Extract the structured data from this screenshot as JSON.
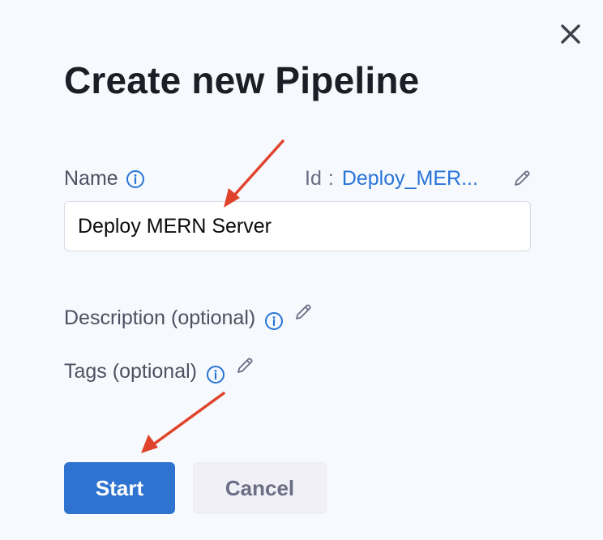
{
  "dialog": {
    "title": "Create new Pipeline",
    "close_icon": "close-icon"
  },
  "name_field": {
    "label": "Name",
    "value": "Deploy MERN Server",
    "info_icon": "info-icon"
  },
  "identifier": {
    "label": "Id",
    "separator": ":",
    "value": "Deploy_MER...",
    "edit_icon": "pencil-icon"
  },
  "description": {
    "label": "Description (optional)",
    "info_icon": "info-icon",
    "edit_icon": "pencil-icon"
  },
  "tags": {
    "label": "Tags (optional)",
    "info_icon": "info-icon",
    "edit_icon": "pencil-icon"
  },
  "actions": {
    "start_label": "Start",
    "cancel_label": "Cancel"
  },
  "colors": {
    "primary": "#2f73d0",
    "link": "#2874d8",
    "annotation_arrow": "#e0432b",
    "background": "#f6f9fd"
  }
}
